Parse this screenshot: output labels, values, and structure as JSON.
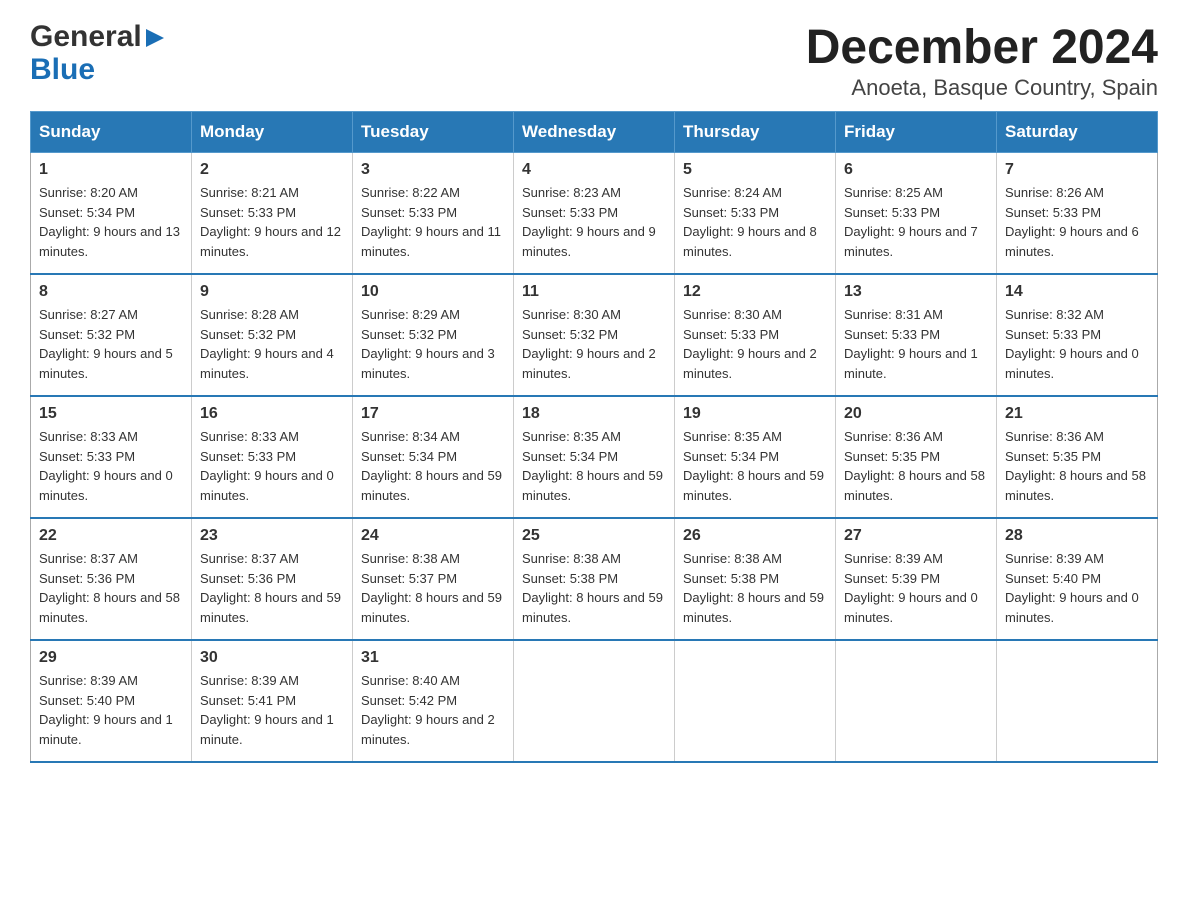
{
  "header": {
    "logo_general": "General",
    "logo_blue": "Blue",
    "title": "December 2024",
    "subtitle": "Anoeta, Basque Country, Spain"
  },
  "weekdays": [
    "Sunday",
    "Monday",
    "Tuesday",
    "Wednesday",
    "Thursday",
    "Friday",
    "Saturday"
  ],
  "weeks": [
    [
      {
        "day": "1",
        "sunrise": "8:20 AM",
        "sunset": "5:34 PM",
        "daylight": "9 hours and 13 minutes."
      },
      {
        "day": "2",
        "sunrise": "8:21 AM",
        "sunset": "5:33 PM",
        "daylight": "9 hours and 12 minutes."
      },
      {
        "day": "3",
        "sunrise": "8:22 AM",
        "sunset": "5:33 PM",
        "daylight": "9 hours and 11 minutes."
      },
      {
        "day": "4",
        "sunrise": "8:23 AM",
        "sunset": "5:33 PM",
        "daylight": "9 hours and 9 minutes."
      },
      {
        "day": "5",
        "sunrise": "8:24 AM",
        "sunset": "5:33 PM",
        "daylight": "9 hours and 8 minutes."
      },
      {
        "day": "6",
        "sunrise": "8:25 AM",
        "sunset": "5:33 PM",
        "daylight": "9 hours and 7 minutes."
      },
      {
        "day": "7",
        "sunrise": "8:26 AM",
        "sunset": "5:33 PM",
        "daylight": "9 hours and 6 minutes."
      }
    ],
    [
      {
        "day": "8",
        "sunrise": "8:27 AM",
        "sunset": "5:32 PM",
        "daylight": "9 hours and 5 minutes."
      },
      {
        "day": "9",
        "sunrise": "8:28 AM",
        "sunset": "5:32 PM",
        "daylight": "9 hours and 4 minutes."
      },
      {
        "day": "10",
        "sunrise": "8:29 AM",
        "sunset": "5:32 PM",
        "daylight": "9 hours and 3 minutes."
      },
      {
        "day": "11",
        "sunrise": "8:30 AM",
        "sunset": "5:32 PM",
        "daylight": "9 hours and 2 minutes."
      },
      {
        "day": "12",
        "sunrise": "8:30 AM",
        "sunset": "5:33 PM",
        "daylight": "9 hours and 2 minutes."
      },
      {
        "day": "13",
        "sunrise": "8:31 AM",
        "sunset": "5:33 PM",
        "daylight": "9 hours and 1 minute."
      },
      {
        "day": "14",
        "sunrise": "8:32 AM",
        "sunset": "5:33 PM",
        "daylight": "9 hours and 0 minutes."
      }
    ],
    [
      {
        "day": "15",
        "sunrise": "8:33 AM",
        "sunset": "5:33 PM",
        "daylight": "9 hours and 0 minutes."
      },
      {
        "day": "16",
        "sunrise": "8:33 AM",
        "sunset": "5:33 PM",
        "daylight": "9 hours and 0 minutes."
      },
      {
        "day": "17",
        "sunrise": "8:34 AM",
        "sunset": "5:34 PM",
        "daylight": "8 hours and 59 minutes."
      },
      {
        "day": "18",
        "sunrise": "8:35 AM",
        "sunset": "5:34 PM",
        "daylight": "8 hours and 59 minutes."
      },
      {
        "day": "19",
        "sunrise": "8:35 AM",
        "sunset": "5:34 PM",
        "daylight": "8 hours and 59 minutes."
      },
      {
        "day": "20",
        "sunrise": "8:36 AM",
        "sunset": "5:35 PM",
        "daylight": "8 hours and 58 minutes."
      },
      {
        "day": "21",
        "sunrise": "8:36 AM",
        "sunset": "5:35 PM",
        "daylight": "8 hours and 58 minutes."
      }
    ],
    [
      {
        "day": "22",
        "sunrise": "8:37 AM",
        "sunset": "5:36 PM",
        "daylight": "8 hours and 58 minutes."
      },
      {
        "day": "23",
        "sunrise": "8:37 AM",
        "sunset": "5:36 PM",
        "daylight": "8 hours and 59 minutes."
      },
      {
        "day": "24",
        "sunrise": "8:38 AM",
        "sunset": "5:37 PM",
        "daylight": "8 hours and 59 minutes."
      },
      {
        "day": "25",
        "sunrise": "8:38 AM",
        "sunset": "5:38 PM",
        "daylight": "8 hours and 59 minutes."
      },
      {
        "day": "26",
        "sunrise": "8:38 AM",
        "sunset": "5:38 PM",
        "daylight": "8 hours and 59 minutes."
      },
      {
        "day": "27",
        "sunrise": "8:39 AM",
        "sunset": "5:39 PM",
        "daylight": "9 hours and 0 minutes."
      },
      {
        "day": "28",
        "sunrise": "8:39 AM",
        "sunset": "5:40 PM",
        "daylight": "9 hours and 0 minutes."
      }
    ],
    [
      {
        "day": "29",
        "sunrise": "8:39 AM",
        "sunset": "5:40 PM",
        "daylight": "9 hours and 1 minute."
      },
      {
        "day": "30",
        "sunrise": "8:39 AM",
        "sunset": "5:41 PM",
        "daylight": "9 hours and 1 minute."
      },
      {
        "day": "31",
        "sunrise": "8:40 AM",
        "sunset": "5:42 PM",
        "daylight": "9 hours and 2 minutes."
      },
      null,
      null,
      null,
      null
    ]
  ]
}
